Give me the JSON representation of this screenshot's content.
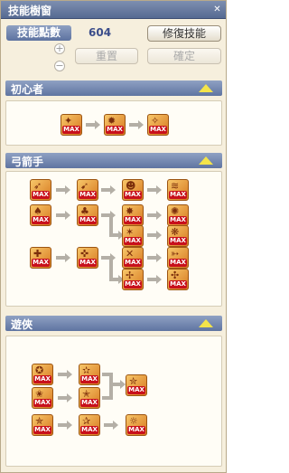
{
  "window": {
    "title": "技能樹窗"
  },
  "points": {
    "label": "技能點數",
    "value": "604"
  },
  "buttons": {
    "repair": "修復技能",
    "reset": "重置",
    "confirm": "確定"
  },
  "stepper": {
    "plus": "+",
    "minus": "−"
  },
  "sections": [
    {
      "title": "初心者"
    },
    {
      "title": "弓箭手"
    },
    {
      "title": "遊俠"
    }
  ],
  "skill": {
    "max_label": "MAX"
  }
}
